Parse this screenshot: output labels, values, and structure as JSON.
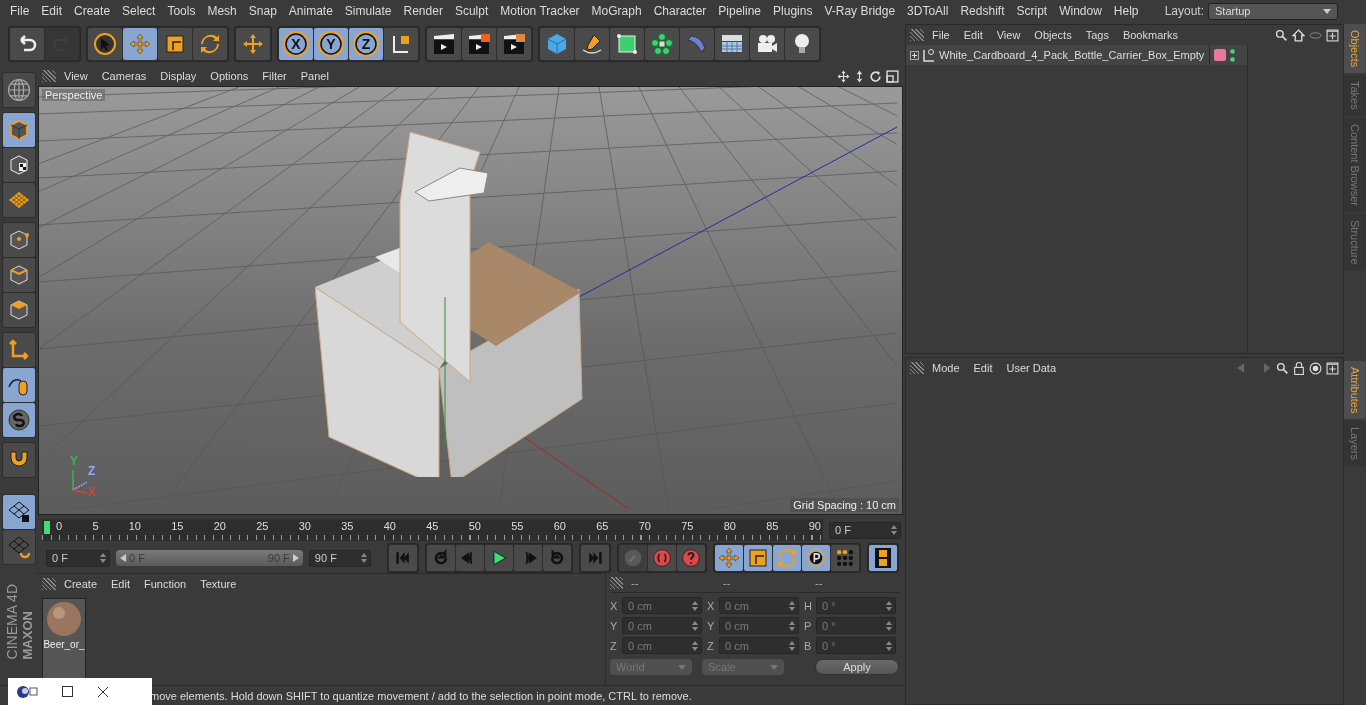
{
  "menu": [
    "File",
    "Edit",
    "Create",
    "Select",
    "Tools",
    "Mesh",
    "Snap",
    "Animate",
    "Simulate",
    "Render",
    "Sculpt",
    "Motion Tracker",
    "MoGraph",
    "Character",
    "Pipeline",
    "Plugins",
    "V-Ray Bridge",
    "3DToAll",
    "Redshift",
    "Script",
    "Window",
    "Help"
  ],
  "layout": {
    "label": "Layout:",
    "value": "Startup"
  },
  "toolbar": [
    [
      {
        "kind": "undo",
        "selected": false,
        "disabled": false
      },
      {
        "kind": "redo",
        "selected": false,
        "disabled": true
      }
    ],
    [
      {
        "kind": "select",
        "selected": false,
        "disabled": false
      },
      {
        "kind": "move",
        "selected": true,
        "disabled": false
      },
      {
        "kind": "scale",
        "selected": false,
        "disabled": false
      },
      {
        "kind": "rotate",
        "selected": false,
        "disabled": false
      }
    ],
    [
      {
        "kind": "add",
        "selected": false,
        "disabled": false
      }
    ],
    [
      {
        "kind": "axis",
        "label": "X",
        "selected": true,
        "disabled": false
      },
      {
        "kind": "axis",
        "label": "Y",
        "selected": true,
        "disabled": false
      },
      {
        "kind": "axis",
        "label": "Z",
        "selected": true,
        "disabled": false
      },
      {
        "kind": "coords",
        "selected": false,
        "disabled": false
      }
    ],
    [
      {
        "kind": "render-view",
        "selected": false,
        "disabled": false
      },
      {
        "kind": "render-picture",
        "selected": false,
        "disabled": false
      },
      {
        "kind": "render-settings",
        "selected": false,
        "disabled": false
      }
    ],
    [
      {
        "kind": "cube",
        "selected": false,
        "disabled": false
      },
      {
        "kind": "pen",
        "selected": false,
        "disabled": false
      },
      {
        "kind": "subdivision",
        "selected": false,
        "disabled": false
      },
      {
        "kind": "cloner",
        "selected": false,
        "disabled": false
      },
      {
        "kind": "deformer",
        "selected": false,
        "disabled": false
      },
      {
        "kind": "floor",
        "selected": false,
        "disabled": false
      },
      {
        "kind": "camera",
        "selected": false,
        "disabled": false
      },
      {
        "kind": "light",
        "selected": false,
        "disabled": false
      }
    ]
  ],
  "left_tools": [
    [
      {
        "kind": "globe",
        "selected": false
      }
    ],
    [
      {
        "kind": "model",
        "selected": true
      },
      {
        "kind": "texture",
        "selected": false
      },
      {
        "kind": "workplane",
        "selected": false
      }
    ],
    [
      {
        "kind": "points",
        "selected": false
      },
      {
        "kind": "edges",
        "selected": false
      },
      {
        "kind": "polygons",
        "selected": false
      }
    ],
    [
      {
        "kind": "axis-l",
        "selected": false
      },
      {
        "kind": "tweak",
        "selected": true
      },
      {
        "kind": "solo",
        "selected": true
      }
    ],
    [
      {
        "kind": "magnet",
        "selected": false
      }
    ],
    [
      {
        "kind": "grid-lock",
        "selected": true
      },
      {
        "kind": "grid-rotate",
        "selected": false
      }
    ]
  ],
  "logo": {
    "brand": "MAXON",
    "product": "CINEMA 4D"
  },
  "viewport": {
    "menu": [
      "View",
      "Cameras",
      "Display",
      "Options",
      "Filter",
      "Panel"
    ],
    "label": "Perspective",
    "grid_spacing": "Grid Spacing : 10 cm",
    "axes": [
      {
        "label": "Y",
        "color": "#3fb34a"
      },
      {
        "label": "Z",
        "color": "#9aa6ff"
      },
      {
        "label": "X",
        "color": "#d94040"
      }
    ]
  },
  "timeline": {
    "ticks": [
      "0",
      "5",
      "10",
      "15",
      "20",
      "25",
      "30",
      "35",
      "40",
      "45",
      "50",
      "55",
      "60",
      "65",
      "70",
      "75",
      "80",
      "85",
      "90"
    ],
    "level": 0,
    "current": "0 F",
    "start": "0 F",
    "range_start": "0 F",
    "range_end": "90 F",
    "end": "90 F"
  },
  "key_buttons": [
    {
      "kind": "keyframe-off",
      "disabled": true
    },
    {
      "kind": "record",
      "disabled": false
    },
    {
      "kind": "auto-key",
      "disabled": false
    }
  ],
  "mode_buttons": [
    {
      "kind": "move",
      "selected": true
    },
    {
      "kind": "scale",
      "selected": true
    },
    {
      "kind": "rotate",
      "selected": true
    },
    {
      "kind": "param",
      "selected": true
    },
    {
      "kind": "points",
      "selected": false
    }
  ],
  "film_button": {
    "selected": true
  },
  "materials": {
    "menu": [
      "Create",
      "Edit",
      "Function",
      "Texture"
    ],
    "items": [
      {
        "name": "Beer_or_"
      }
    ]
  },
  "coordinates": {
    "headers": [
      "--",
      "--",
      "--"
    ],
    "columns": [
      [
        {
          "axis": "X",
          "value": "0 cm"
        },
        {
          "axis": "Y",
          "value": "0 cm"
        },
        {
          "axis": "Z",
          "value": "0 cm"
        }
      ],
      [
        {
          "axis": "X",
          "value": "0 cm"
        },
        {
          "axis": "Y",
          "value": "0 cm"
        },
        {
          "axis": "Z",
          "value": "0 cm"
        }
      ],
      [
        {
          "axis": "H",
          "value": "0 °"
        },
        {
          "axis": "P",
          "value": "0 °"
        },
        {
          "axis": "B",
          "value": "0 °"
        }
      ]
    ],
    "mode": "World",
    "size_mode": "Scale",
    "apply": "Apply"
  },
  "status_bar": "move elements. Hold down SHIFT to quantize movement / add to the selection in point mode, CTRL to remove.",
  "objects": {
    "menu": [
      "File",
      "Edit",
      "View",
      "Objects",
      "Tags",
      "Bookmarks"
    ],
    "items": [
      {
        "name": "White_Cardboard_4_Pack_Bottle_Carrier_Box_Empty",
        "expanded": false
      }
    ]
  },
  "attributes": {
    "menu": [
      "Mode",
      "Edit",
      "User Data"
    ]
  },
  "side_tabs_top": [
    {
      "label": "Objects",
      "selected": true
    },
    {
      "label": "Takes",
      "selected": false
    },
    {
      "label": "Content Browser",
      "selected": false
    },
    {
      "label": "Structure",
      "selected": false
    }
  ],
  "side_tabs_bottom": [
    {
      "label": "Attributes",
      "selected": true
    },
    {
      "label": "Layers",
      "selected": false
    }
  ]
}
